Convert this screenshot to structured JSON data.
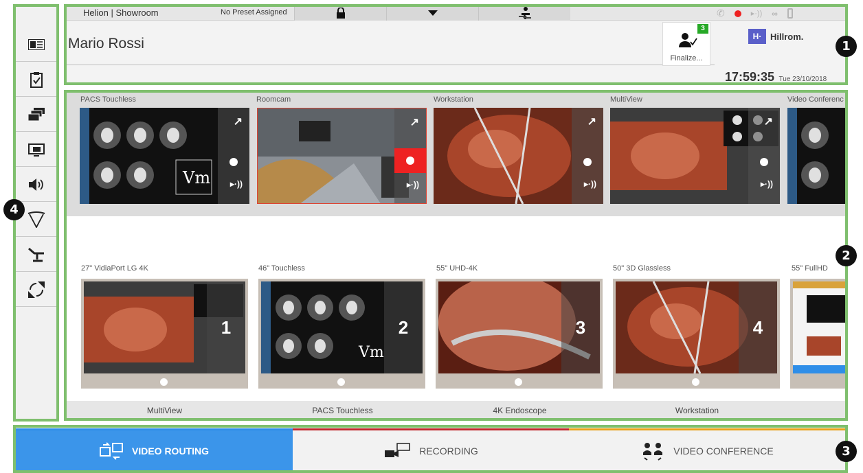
{
  "header": {
    "breadcrumb_site": "Helion",
    "breadcrumb_sep": "|",
    "breadcrumb_room": "Showroom",
    "preset": "No Preset Assigned",
    "patient_name": "Mario Rossi",
    "finalize_label": "Finalize...",
    "finalize_count": "3",
    "logo_mark": "H·",
    "logo_text": "Hillrom.",
    "time": "17:59:35",
    "date": "Tue 23/10/2018",
    "toolbar_icons": [
      "lock-icon",
      "chevron-down-icon",
      "transfer-icon"
    ],
    "status_icons": [
      "phone-icon",
      "record-dot-icon",
      "stream-icon",
      "glasses-icon",
      "bottle-icon"
    ]
  },
  "sources": [
    {
      "label": "PACS Touchless",
      "image": "pacs"
    },
    {
      "label": "Roomcam",
      "image": "room",
      "recording": true
    },
    {
      "label": "Workstation",
      "image": "surgery"
    },
    {
      "label": "MultiView",
      "image": "multiview"
    },
    {
      "label": "Video Conferenc",
      "image": "pacs"
    }
  ],
  "destinations": [
    {
      "label": "27\" VidiaPort LG 4K",
      "number": "1",
      "source": "MultiView",
      "image": "multiview"
    },
    {
      "label": "46\" Touchless",
      "number": "2",
      "source": "PACS Touchless",
      "image": "pacs"
    },
    {
      "label": "55\" UHD-4K",
      "number": "3",
      "source": "4K Endoscope",
      "image": "endo"
    },
    {
      "label": "50\" 3D Glassless",
      "number": "4",
      "source": "Workstation",
      "image": "surgery"
    },
    {
      "label": "55\" FullHD",
      "number": "",
      "source": "",
      "image": "software"
    }
  ],
  "sidebar": {
    "items": [
      "patient-card-icon",
      "clipboard-check-icon",
      "stacked-windows-icon",
      "display-icon",
      "speaker-icon",
      "surgical-light-icon",
      "operating-table-icon",
      "fullscreen-arrows-icon"
    ]
  },
  "tabs": [
    {
      "label": "VIDEO ROUTING",
      "active": true,
      "accent": "#2f8ee8"
    },
    {
      "label": "RECORDING",
      "active": false,
      "accent": "#c0282d"
    },
    {
      "label": "VIDEO CONFERENCE",
      "active": false,
      "accent": "#e8a21a"
    }
  ],
  "callouts": [
    "1",
    "2",
    "3",
    "4"
  ],
  "colors": {
    "frame": "#7fbf6e",
    "active_tab": "#3b95ea",
    "record_red": "#ee2222",
    "badge_green": "#27a927",
    "logo_blue": "#5a5fc9"
  }
}
